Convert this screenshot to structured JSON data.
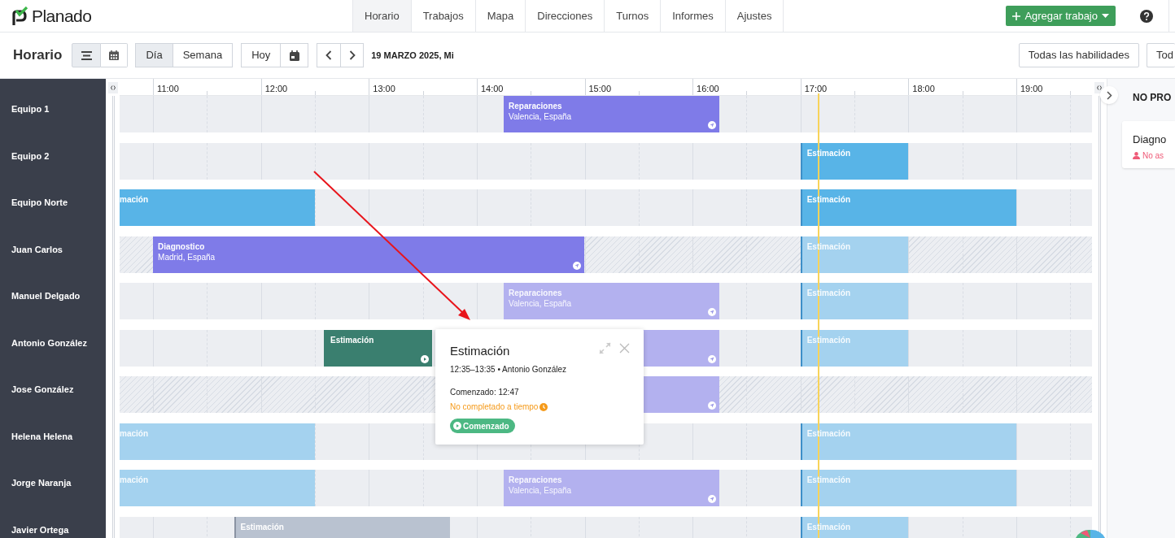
{
  "app": {
    "logo": "Planado"
  },
  "nav": [
    {
      "label": "Horario",
      "selected": true
    },
    {
      "label": "Trabajos",
      "selected": false
    },
    {
      "label": "Mapa",
      "selected": false
    },
    {
      "label": "Direcciones",
      "selected": false
    },
    {
      "label": "Turnos",
      "selected": false
    },
    {
      "label": "Informes",
      "selected": false
    },
    {
      "label": "Ajustes",
      "selected": false
    }
  ],
  "add_button": "Agregar trabajo",
  "toolbar": {
    "title": "Horario",
    "view_modes": [
      {
        "kind": "list",
        "selected": true
      },
      {
        "kind": "calendar",
        "selected": false
      }
    ],
    "periods": [
      {
        "label": "Día",
        "selected": true
      },
      {
        "label": "Semana",
        "selected": false
      }
    ],
    "today": "Hoy",
    "date": "19 MARZO 2025, Mi",
    "filters": [
      "Todas las habilidades",
      "Tod"
    ]
  },
  "timeline": {
    "hours": [
      "11:00",
      "12:00",
      "13:00",
      "14:00",
      "15:00",
      "16:00",
      "17:00",
      "18:00",
      "19:00"
    ],
    "rows": [
      {
        "name": "Equipo 1",
        "hatched": false,
        "jobs": [
          {
            "kind": "repair",
            "faded": false,
            "title": "Reparaciones",
            "address": "Valencia, España"
          }
        ]
      },
      {
        "name": "Equipo 2",
        "hatched": false,
        "jobs": [
          {
            "kind": "estimate",
            "faded": false,
            "title": "Estimación"
          }
        ]
      },
      {
        "name": "Equipo Norte",
        "hatched": false,
        "jobs": [
          {
            "kind": "estimate",
            "faded": false,
            "title": "mación"
          },
          {
            "kind": "estimate",
            "faded": false,
            "title": "Estimación"
          }
        ]
      },
      {
        "name": "Juan Carlos",
        "hatched": true,
        "jobs": [
          {
            "kind": "repair",
            "faded": false,
            "title": "Diagnostico",
            "address": "Madrid, España"
          },
          {
            "kind": "estimate",
            "faded": true,
            "title": "Estimación"
          }
        ]
      },
      {
        "name": "Manuel Delgado",
        "hatched": false,
        "jobs": [
          {
            "kind": "repair",
            "faded": true,
            "title": "Reparaciones",
            "address": "Valencia, España"
          },
          {
            "kind": "estimate",
            "faded": true,
            "title": "Estimación"
          }
        ]
      },
      {
        "name": "Antonio González",
        "hatched": false,
        "jobs": [
          {
            "kind": "started",
            "faded": false,
            "title": "Estimación"
          },
          {
            "kind": "repair",
            "faded": true
          },
          {
            "kind": "estimate",
            "faded": true,
            "title": "Estimación"
          }
        ]
      },
      {
        "name": "Jose González",
        "hatched": true,
        "jobs": [
          {
            "kind": "repair",
            "faded": true
          }
        ]
      },
      {
        "name": "Helena Helena",
        "hatched": false,
        "jobs": [
          {
            "kind": "estimate",
            "faded": true,
            "title": "mación"
          },
          {
            "kind": "estimate",
            "faded": true,
            "title": "Estimación"
          }
        ]
      },
      {
        "name": "Jorge Naranja",
        "hatched": false,
        "jobs": [
          {
            "kind": "estimate",
            "faded": true,
            "title": "mación"
          },
          {
            "kind": "repair",
            "faded": true,
            "title": "Reparaciones",
            "address": "Valencia, España"
          },
          {
            "kind": "estimate",
            "faded": true,
            "title": "Estimación"
          }
        ]
      },
      {
        "name": "Javier Ortega",
        "hatched": false,
        "jobs": [
          {
            "kind": "pending",
            "faded": false,
            "title": "Estimación"
          },
          {
            "kind": "estimate",
            "faded": true,
            "title": "Estimación"
          }
        ]
      }
    ]
  },
  "popup": {
    "title": "Estimación",
    "subtitle": "12:35–13:35 • Antonio González",
    "started": "Comenzado: 12:47",
    "warning": "No completado a tiempo",
    "status": "Comenzado"
  },
  "side_panel": {
    "title": "NO PRO",
    "cards": [
      {
        "title": "Diagno",
        "note": "No as"
      }
    ]
  }
}
